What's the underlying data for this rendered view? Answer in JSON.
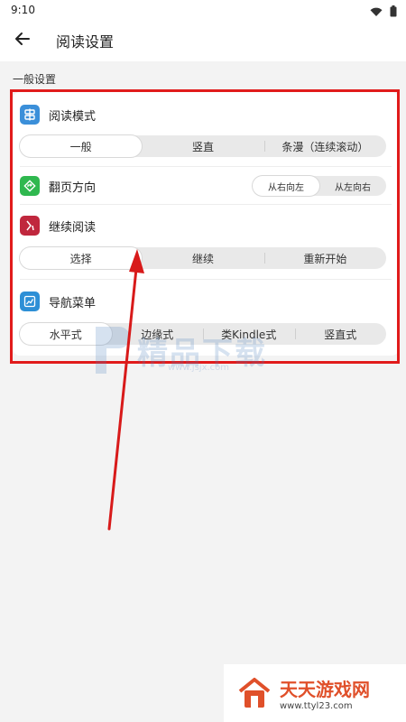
{
  "status_bar": {
    "time": "9:10"
  },
  "app_bar": {
    "title": "阅读设置"
  },
  "section": {
    "label": "一般设置"
  },
  "settings": {
    "reading_mode": {
      "label": "阅读模式",
      "options": [
        "一般",
        "竖直",
        "条漫（连续滚动）"
      ],
      "selected": "一般"
    },
    "page_direction": {
      "label": "翻页方向",
      "options": [
        "从右向左",
        "从左向右"
      ],
      "selected": "从右向左"
    },
    "continue_reading": {
      "label": "继续阅读",
      "options": [
        "选择",
        "继续",
        "重新开始"
      ],
      "selected": "选择"
    },
    "nav_menu": {
      "label": "导航菜单",
      "options": [
        "水平式",
        "边缘式",
        "类Kindle式",
        "竖直式"
      ],
      "selected": "水平式"
    }
  },
  "watermark": {
    "text": "精品下载",
    "sub": "www.jsjx.com"
  },
  "corner_logo": {
    "text": "天天游戏网",
    "sub": "www.ttyl23.com"
  },
  "colors": {
    "highlight": "#e11b1b",
    "arrow": "#d81a1a",
    "mode_icon": "#3b8fd9",
    "direction_icon": "#2fb84f",
    "continue_icon": "#c0273d",
    "nav_icon": "#2d8fd6"
  },
  "icons": {
    "back": "arrow-left-icon",
    "wifi": "wifi-icon",
    "battery": "battery-icon",
    "mode": "layout-icon",
    "direction": "turn-arrow-icon",
    "continue": "resume-icon",
    "nav": "chart-icon"
  }
}
